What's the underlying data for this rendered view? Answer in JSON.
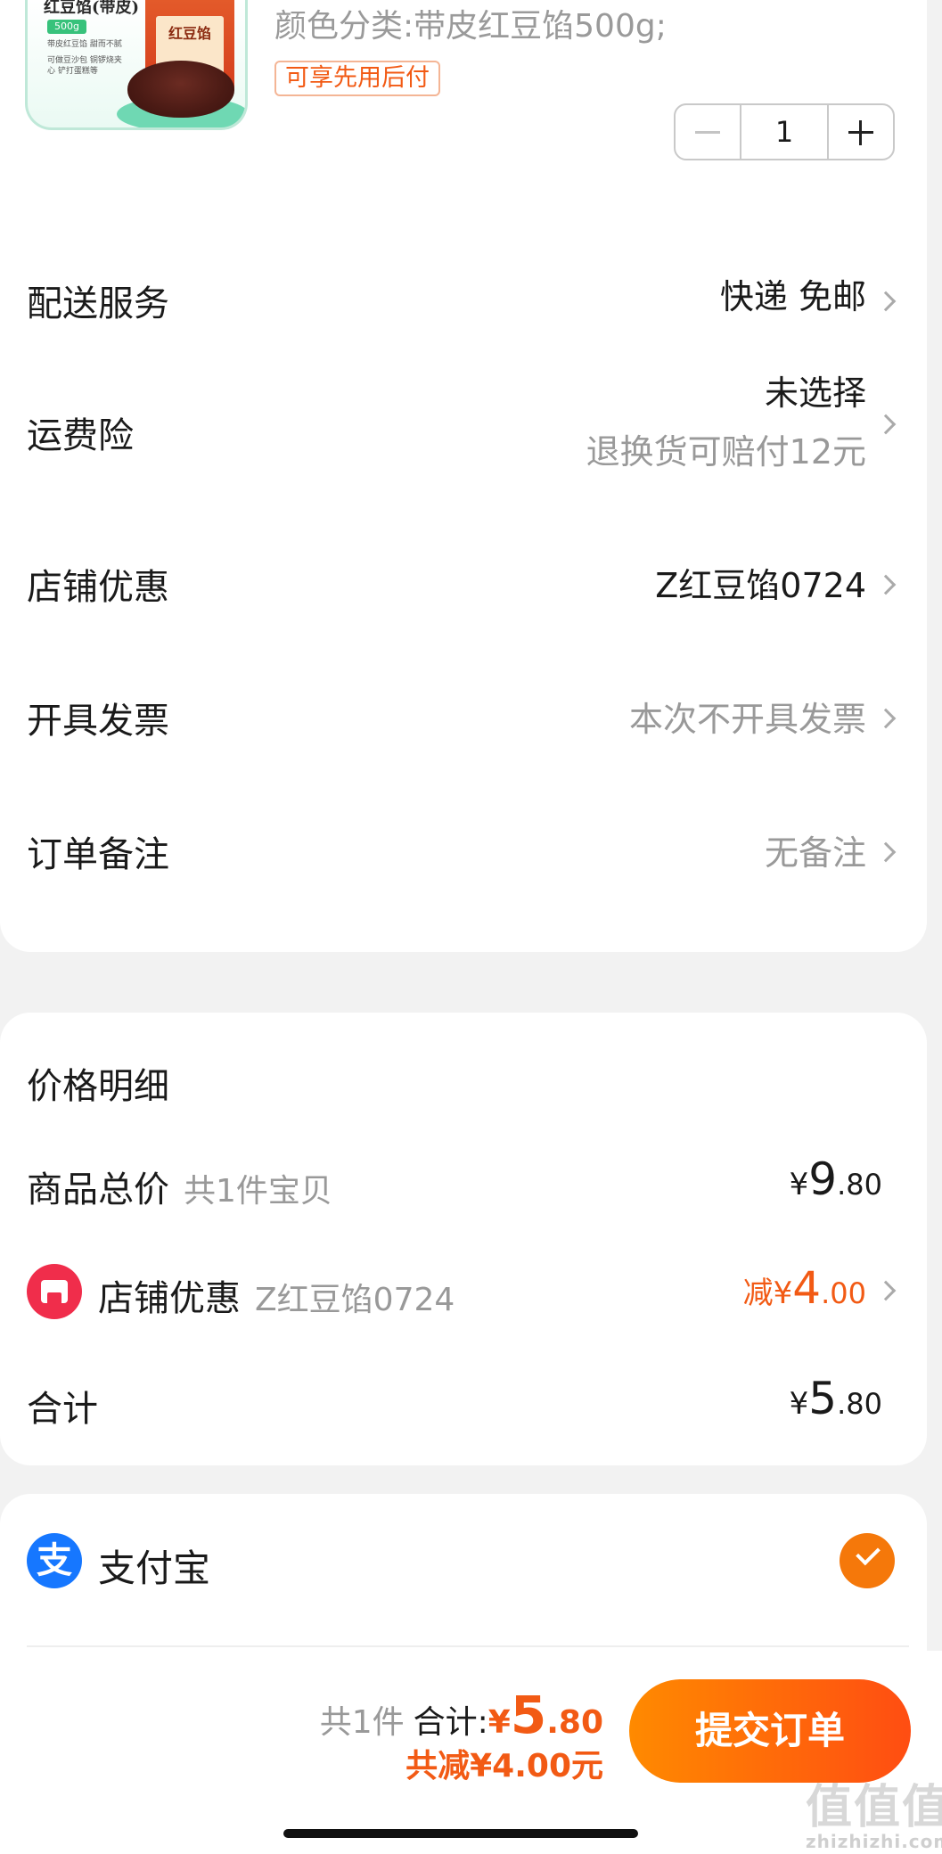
{
  "product": {
    "image": {
      "title": "红豆馅(带皮)",
      "weight_tag": "500g",
      "bullets": [
        "带皮红豆馅 甜而不腻",
        "可做豆沙包 铜锣烧夹",
        "心 铲打蛋糕等"
      ],
      "bag_title": "红豆馅"
    },
    "spec": "颜色分类:带皮红豆馅500g;",
    "pay_later": "可享先用后付",
    "quantity": "1"
  },
  "options": {
    "delivery": {
      "label": "配送服务",
      "value": "快递 免邮"
    },
    "shipping_insurance": {
      "label": "运费险",
      "value": "未选择",
      "sub": "退换货可赔付12元"
    },
    "shop_discount": {
      "label": "店铺优惠",
      "value": "Z红豆馅0724"
    },
    "invoice": {
      "label": "开具发票",
      "value": "本次不开具发票"
    },
    "remark": {
      "label": "订单备注",
      "value": "无备注"
    }
  },
  "price_detail": {
    "title": "价格明细",
    "goods_total": {
      "label": "商品总价",
      "note": "共1件宝贝",
      "symbol": "¥",
      "int": "9",
      "dec": ".80"
    },
    "shop_discount": {
      "label": "店铺优惠",
      "note": "Z红豆馅0724",
      "prefix": "减¥",
      "int": "4",
      "dec": ".00"
    },
    "total": {
      "label": "合计",
      "symbol": "¥",
      "int": "5",
      "dec": ".80"
    }
  },
  "payment": {
    "method": "支付宝",
    "icon_glyph": "支"
  },
  "bottom_bar": {
    "count": "共1件",
    "total_label": "合计:",
    "total_symbol": "¥",
    "total_int": "5",
    "total_dec": ".80",
    "saved": "共减¥4.00元",
    "submit": "提交订单"
  },
  "watermark": {
    "big": "值值值",
    "small": "zhizhizhi.com"
  },
  "colors": {
    "accent": "#f25a14",
    "button_start": "#ff8a00",
    "button_end": "#ff4d12",
    "alipay": "#1677ff",
    "shop_red": "#f02d4b"
  }
}
